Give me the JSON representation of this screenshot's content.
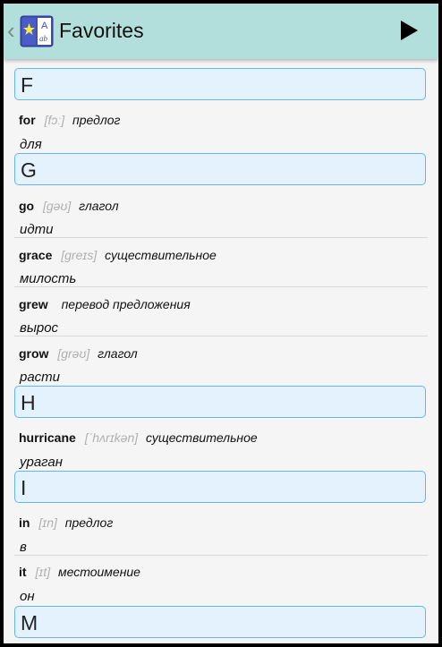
{
  "header": {
    "title": "Favorites",
    "icon_letter": "A",
    "icon_glyph": "ab",
    "back_icon": "chevron-left-icon",
    "play_icon": "play-icon"
  },
  "sections": [
    {
      "letter": "F",
      "entries": [
        {
          "word": "for",
          "transcription": "[fɔː]",
          "pos": "предлог",
          "translation": "для"
        }
      ]
    },
    {
      "letter": "G",
      "entries": [
        {
          "word": "go",
          "transcription": "[gəʊ]",
          "pos": "глагол",
          "translation": "идти"
        },
        {
          "word": "grace",
          "transcription": "[greɪs]",
          "pos": "существительное",
          "translation": "милость"
        },
        {
          "word": "grew",
          "transcription": "",
          "pos": "перевод предложения",
          "translation": "вырос"
        },
        {
          "word": "grow",
          "transcription": "[grəʊ]",
          "pos": "глагол",
          "translation": "расти"
        }
      ]
    },
    {
      "letter": "H",
      "entries": [
        {
          "word": "hurricane",
          "transcription": "[ˈhʌrɪkən]",
          "pos": "существительное",
          "translation": "ураган"
        }
      ]
    },
    {
      "letter": "I",
      "entries": [
        {
          "word": "in",
          "transcription": "[ɪn]",
          "pos": "предлог",
          "translation": "в"
        },
        {
          "word": "it",
          "transcription": "[ɪt]",
          "pos": "местоимение",
          "translation": "он"
        }
      ]
    },
    {
      "letter": "M",
      "entries": []
    }
  ]
}
